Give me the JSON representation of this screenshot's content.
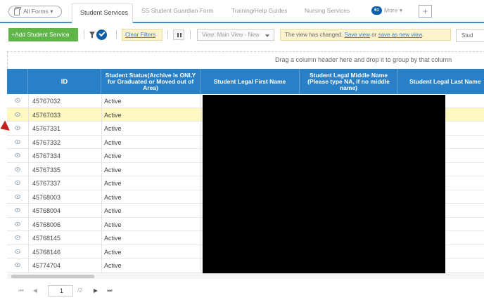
{
  "tabs": {
    "all_forms": "All Forms",
    "active": "Student Services",
    "items": [
      "SS Student Guardian Form",
      "Training/Help Guides",
      "Nursing Services"
    ],
    "more_badge": "61",
    "more_label": "More",
    "add_tab": "+"
  },
  "toolbar": {
    "add_button": "+Add Student Service",
    "clear_filters": "Clear Filters",
    "view_select": "View: Main View - New",
    "view_message_prefix": "The view has changed.",
    "save_view": "Save view",
    "or": "or",
    "save_as_new_view": "save as new view",
    "period": ".",
    "search_box": "Stud"
  },
  "group_panel": "Drag a column header here and drop it to group by that column",
  "columns": [
    "",
    "ID",
    "Student Status(Archive is ONLY for Graduated or Moved out of Area)",
    "Student Legal First Name",
    "Student Legal Middle Name (Please type NA, if no middle name)",
    "Student Legal Last Name"
  ],
  "rows": [
    {
      "id": "45767032",
      "status": "Active"
    },
    {
      "id": "45767033",
      "status": "Active"
    },
    {
      "id": "45767331",
      "status": "Active"
    },
    {
      "id": "45767332",
      "status": "Active"
    },
    {
      "id": "45767334",
      "status": "Active"
    },
    {
      "id": "45767335",
      "status": "Active"
    },
    {
      "id": "45767337",
      "status": "Active"
    },
    {
      "id": "45768003",
      "status": "Active"
    },
    {
      "id": "45768004",
      "status": "Active"
    },
    {
      "id": "45768006",
      "status": "Active"
    },
    {
      "id": "45768145",
      "status": "Active"
    },
    {
      "id": "45768146",
      "status": "Active"
    },
    {
      "id": "45774704",
      "status": "Active"
    }
  ],
  "selected_row_index": 1,
  "pager": {
    "first": "⏮",
    "prev": "◀",
    "current_page": "1",
    "total": "/2",
    "next": "▶",
    "last": "⏭"
  },
  "colors": {
    "header_blue": "#2980c7",
    "add_green": "#5fb548",
    "highlight_yellow": "#fdf7c0",
    "arrow_red": "#c4201d"
  }
}
